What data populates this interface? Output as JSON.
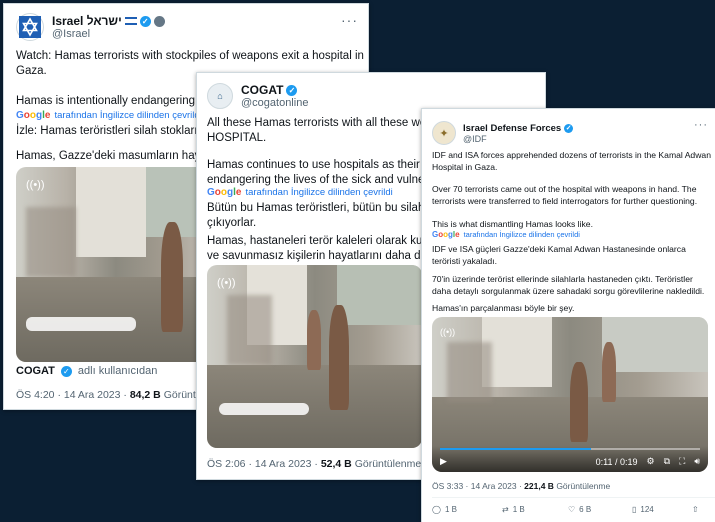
{
  "tweets": [
    {
      "name": "Israel ישראל",
      "handle": "@Israel",
      "lines": [
        "Watch: Hamas terrorists with stockpiles of weapons exit a hospital in",
        "Gaza.",
        "Hamas is intentionally endangering th",
        "İzle: Hamas teröristleri silah stoklarıyla",
        "Hamas, Gazze'deki masumların hayatl"
      ],
      "translate_label": "tarafından İngilizce dilinden çevrildi",
      "quoted_name": "COGAT",
      "quoted_handle": "adlı kullanıcıdan",
      "time": "ÖS 4:20 · 14 Ara 2023 ·",
      "views": "84,2 B",
      "views_label": "Görüntülenme"
    },
    {
      "name": "COGAT",
      "handle": "@cogatonline",
      "lines": [
        "All these Hamas terrorists with all these weapon",
        "HOSPITAL.",
        "Hamas continues to use hospitals as their terror",
        "endangering the lives of the sick and vulnerable.",
        "Bütün bu Hamas teröristleri, bütün bu silahlarla b",
        "çıkıyorlar.",
        "Hamas, hastaneleri terör kaleleri olarak kullanm",
        "ve savunmasız kişilerin hayatlarını daha da tehlik"
      ],
      "translate_label": "tarafından İngilizce dilinden çevrildi",
      "time": "ÖS 2:06 · 14 Ara 2023 ·",
      "views": "52,4 B",
      "views_label": "Görüntülenme"
    },
    {
      "name": "Israel Defense Forces",
      "handle": "@IDF",
      "lines": [
        "IDF and ISA forces apprehended dozens of terrorists in the Kamal Adwan",
        "Hospital in Gaza.",
        "Over 70 terrorists came out of the hospital with weapons in hand. The",
        "terrorists were transferred to field interrogators for further questioning.",
        "This is what dismantling Hamas looks like.",
        "IDF ve ISA güçleri Gazze'deki Kamal Adwan Hastanesinde onlarca",
        "teröristi yakaladı.",
        "70'in üzerinde terörist ellerinde silahlarla hastaneden çıktı. Teröristler",
        "daha detaylı sorgulanmak üzere sahadaki sorgu görevlilerine nakledildi.",
        "Hamas'ın parçalanması böyle bir şey."
      ],
      "translate_label": "tarafından İngilizce dilinden çevrildi",
      "video_time": "0:11 / 0:19",
      "time": "ÖS 3:33 · 14 Ara 2023 ·",
      "views": "221,4 B",
      "views_label": "Görüntülenme",
      "replies": "1 B",
      "retweets": "1 B",
      "likes": "6 B",
      "bookmarks": "124"
    }
  ],
  "google_word": "Google",
  "more_glyph": "···",
  "colors": {
    "background": "#0b1f33",
    "verified": "#1d9bf0",
    "link": "#1a73e8"
  }
}
